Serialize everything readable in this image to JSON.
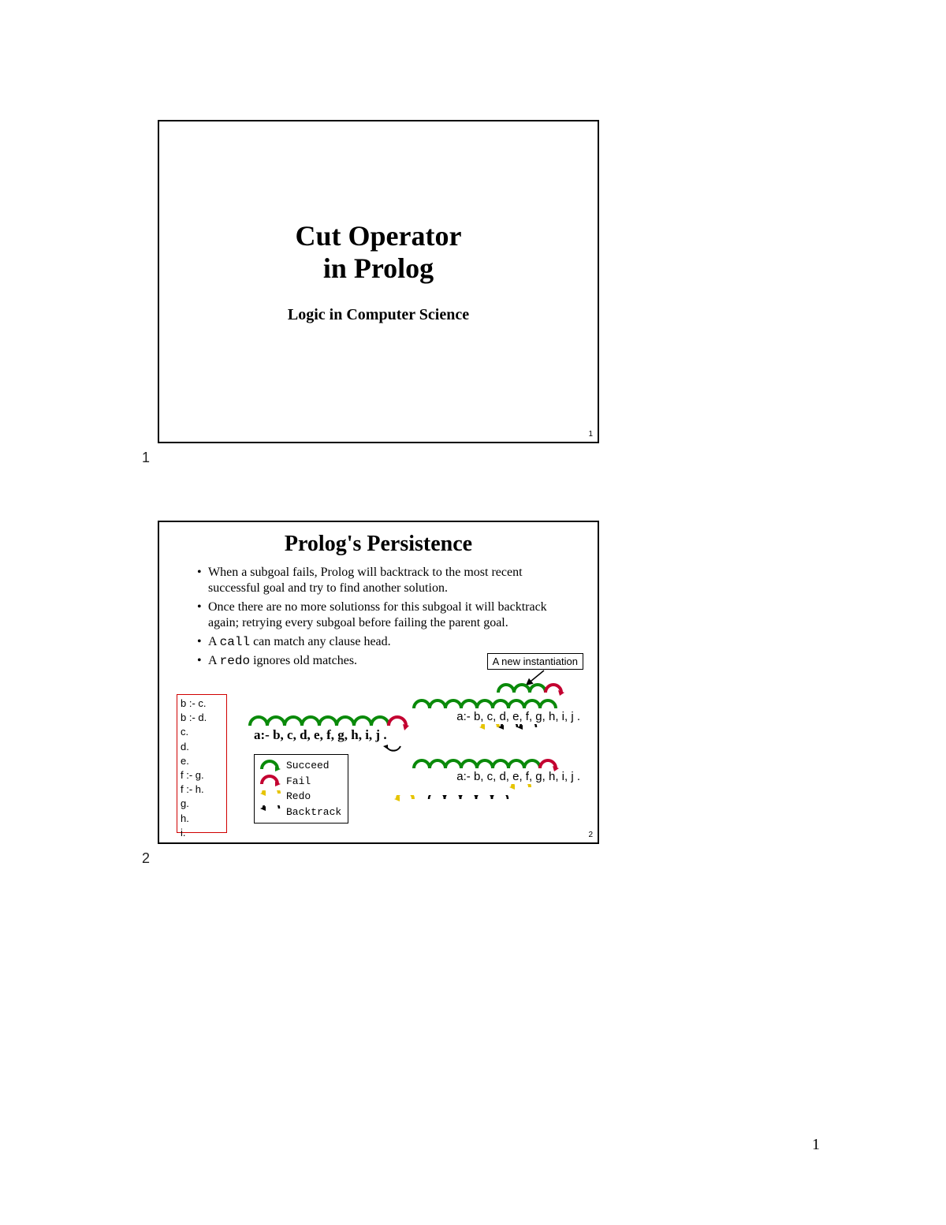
{
  "page_number": "1",
  "slide1": {
    "num": "1",
    "title_l1": "Cut Operator",
    "title_l2": "in Prolog",
    "subtitle": "Logic in Computer Science",
    "inslide_num": "1"
  },
  "slide2": {
    "num": "2",
    "title": "Prolog's Persistence",
    "bullets": [
      "When a subgoal fails, Prolog will backtrack to the most recent successful goal and try to find another solution.",
      "Once there are no more solutionss for this subgoal it will backtrack again; retrying every subgoal before failing the parent goal.",
      "A call can match any clause head.",
      "A redo ignores old matches."
    ],
    "callout": "A new instantiation",
    "facts": [
      "b :- c.",
      "b :- d.",
      "c.",
      "d.",
      "e.",
      "f :- g.",
      "f :- h.",
      "g.",
      "h.",
      "i."
    ],
    "main_rule": "a:- b, c, d, e, f, g, h, i, j .",
    "legend": {
      "succeed": "Succeed",
      "fail": "Fail",
      "redo": "Redo",
      "backtrack": "Backtrack"
    },
    "rclause1": "a:- b, c, d, e, f, g, h, i, j .",
    "rclause2": "a:- b, c, d, e, f, g, h, i, j .",
    "inslide_num": "2"
  }
}
